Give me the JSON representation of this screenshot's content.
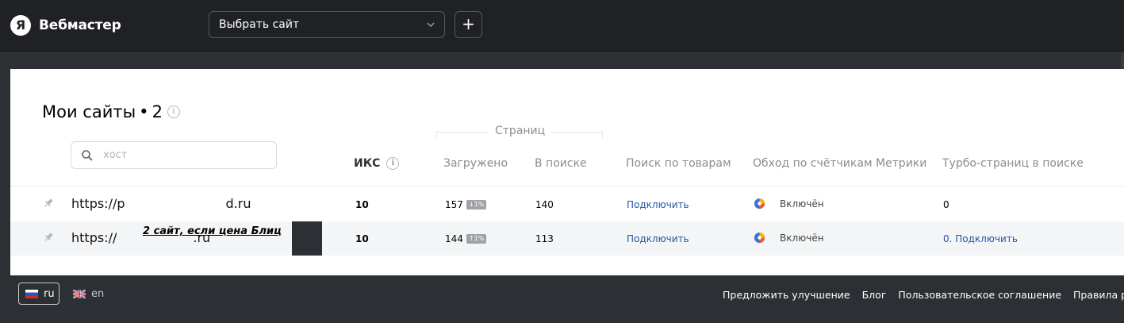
{
  "header": {
    "brand_letter": "Я",
    "brand_name": "Вебмастер",
    "site_select_value": "Выбрать сайт",
    "add_button_label": "+"
  },
  "main": {
    "title": "Мои сайты",
    "count_separator": "•",
    "count": "2",
    "search_placeholder": "хост",
    "group_label": "Страниц",
    "columns": {
      "iks": "ИКС",
      "loaded": "Загружено",
      "in_search": "В поиске",
      "goods": "Поиск по товарам",
      "metrika": "Обход по счётчикам Метрики",
      "turbo": "Турбо-страниц в поиске"
    },
    "rows": [
      {
        "url_start": "https://p",
        "url_end": "d.ru",
        "iks": "10",
        "loaded": "157",
        "loaded_badge": "↓1%",
        "in_search": "140",
        "goods": "Подключить",
        "metrika": "Включён",
        "turbo": "0"
      },
      {
        "url_start": "https://",
        "url_end": ".ru",
        "note": "2 сайт, если цена Блиц",
        "iks": "10",
        "loaded": "144",
        "loaded_badge": "↑1%",
        "in_search": "113",
        "goods": "Подключить",
        "metrika": "Включён",
        "turbo": "0. Подключить"
      }
    ]
  },
  "footer": {
    "lang_ru": "ru",
    "lang_en": "en",
    "links": [
      "Предложить улучшение",
      "Блог",
      "Пользовательское соглашение",
      "Правила рекоме"
    ]
  },
  "colors": {
    "header_bg": "#1f2125",
    "page_bg": "#2c2f33",
    "link": "#2456a6"
  }
}
